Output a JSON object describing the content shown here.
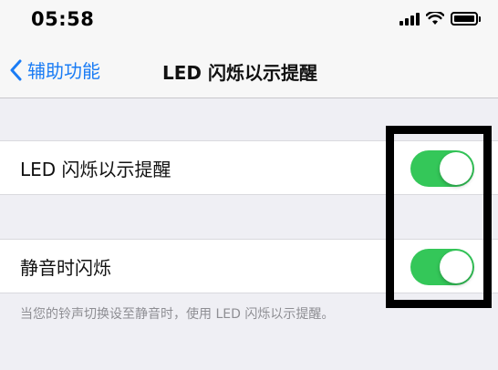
{
  "status_bar": {
    "time": "05:58",
    "icons": [
      "signal-icon",
      "wifi-icon",
      "battery-icon"
    ]
  },
  "nav": {
    "back_label": "辅助功能",
    "title": "LED 闪烁以示提醒"
  },
  "settings": [
    {
      "label": "LED 闪烁以示提醒",
      "enabled": true
    },
    {
      "label": "静音时闪烁",
      "enabled": true
    }
  ],
  "footer_note": "当您的铃声切换设至静音时，使用 LED 闪烁以示提醒。",
  "colors": {
    "accent": "#1a7cf5",
    "toggle_on": "#34c759",
    "background": "#efeff4"
  }
}
